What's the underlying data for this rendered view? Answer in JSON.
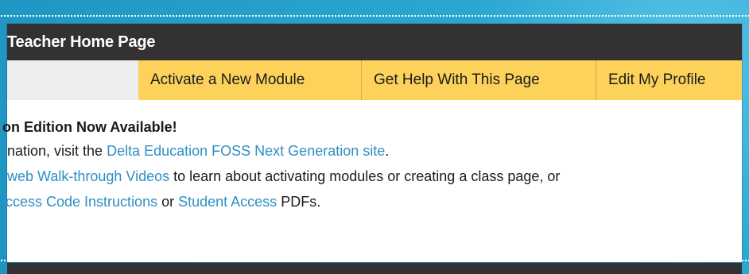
{
  "header": {
    "title": "Teacher Home Page"
  },
  "nav": {
    "tabs": [
      {
        "label": "Activate a New Module"
      },
      {
        "label": "Get Help With This Page"
      },
      {
        "label": "Edit My Profile"
      }
    ]
  },
  "announcement": {
    "heading": "on Edition Now Available!",
    "line2_pre": "nation, visit the ",
    "line2_link": "Delta Education FOSS Next Generation site",
    "line2_post": ".",
    "line3_link": "web Walk-through Videos",
    "line3_post": " to learn about activating modules or creating a class page, or",
    "line4_link1": "ccess Code Instructions",
    "line4_mid": " or ",
    "line4_link2": "Student Access",
    "line4_post": " PDFs."
  },
  "colors": {
    "title_bar": "#333131",
    "nav_tabs": "#fdd25b",
    "link": "#2e8fc4",
    "background": "#2aa7d1"
  }
}
